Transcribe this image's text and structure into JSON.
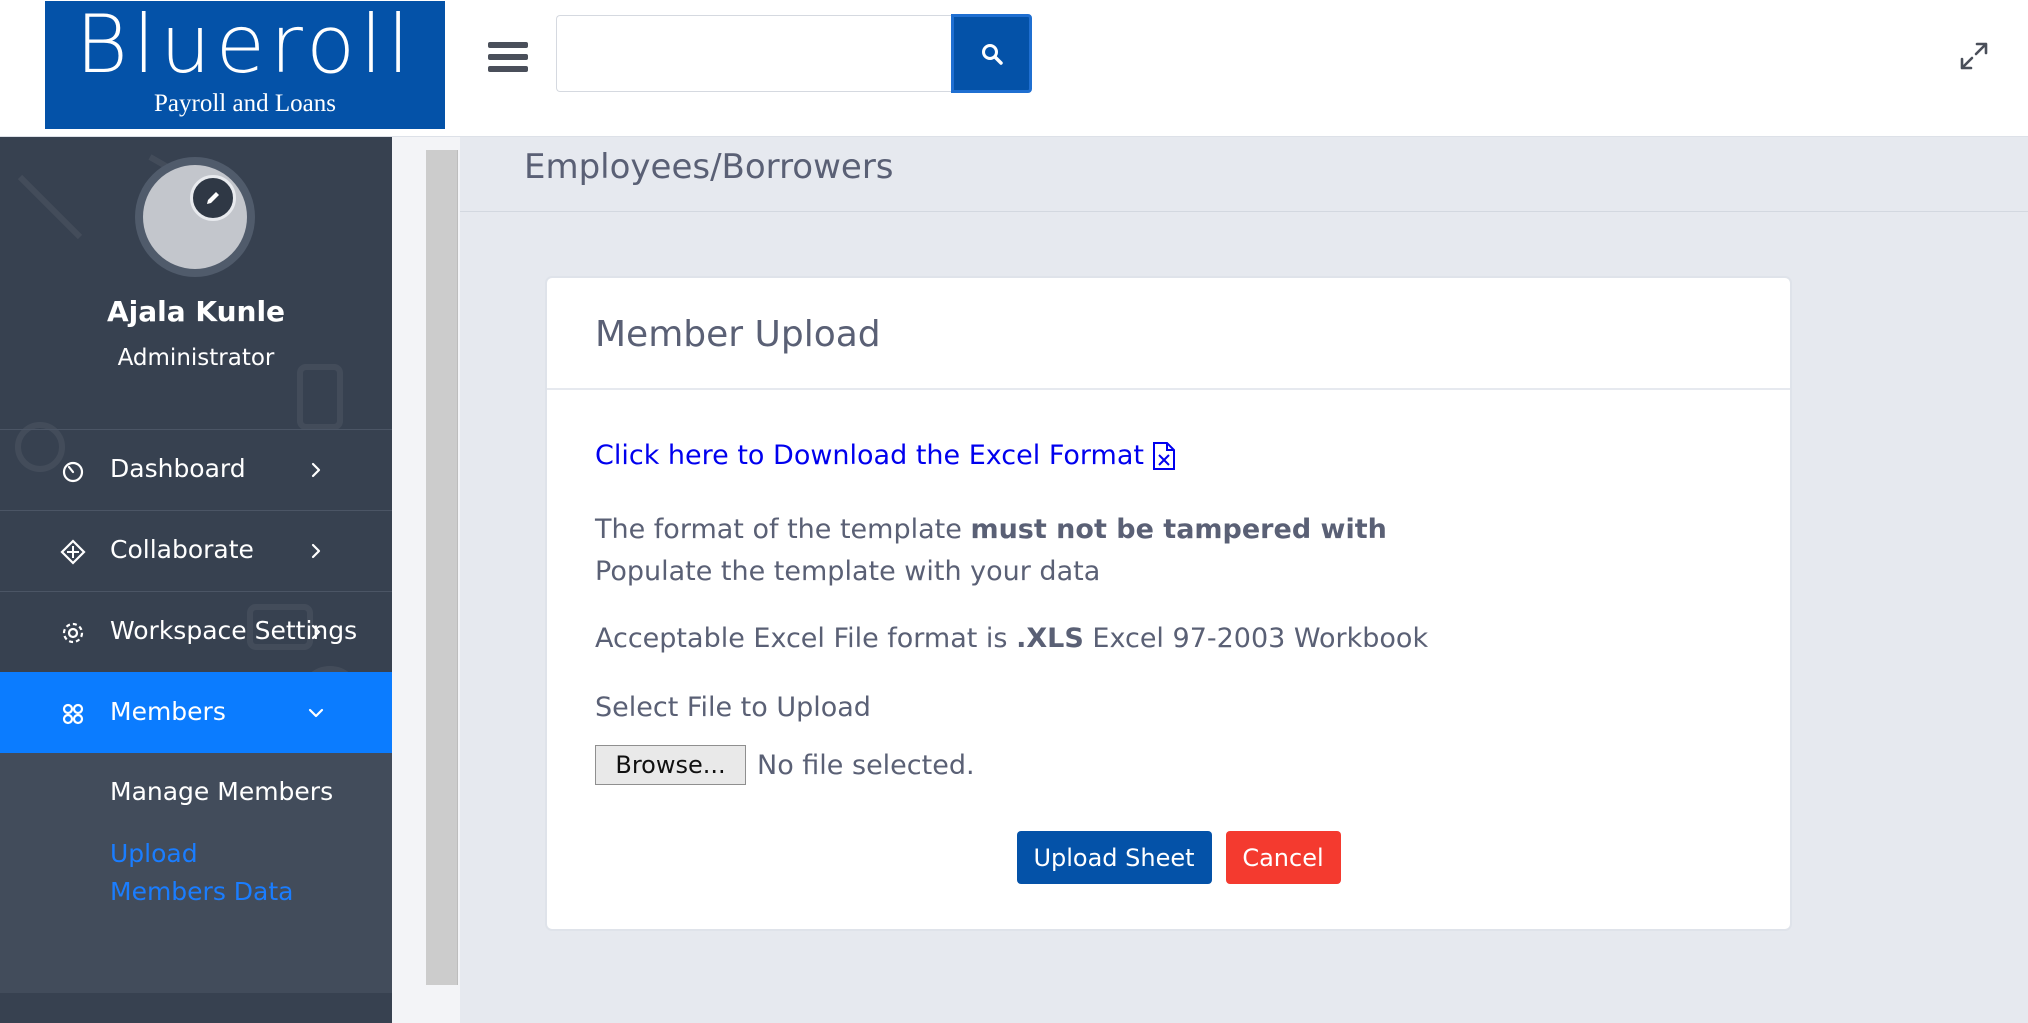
{
  "brand": {
    "name": "Blueroll",
    "tagline": "Payroll and Loans",
    "color": "#0452a8"
  },
  "header": {
    "search": {
      "placeholder": "",
      "value": "",
      "icon": "search-icon"
    },
    "menu_icon": "hamburger-icon",
    "expand_icon": "expand-icon"
  },
  "user": {
    "name": "Ajala Kunle",
    "role": "Administrator",
    "edit_icon": "pencil-icon"
  },
  "sidebar": {
    "items": [
      {
        "label": "Dashboard",
        "icon": "dashboard-icon",
        "chevron": "chevron-right-icon"
      },
      {
        "label": "Collaborate",
        "icon": "collaborate-icon",
        "chevron": "chevron-right-icon"
      },
      {
        "label": "Workspace Settings",
        "icon": "gear-icon",
        "chevron": "chevron-right-icon"
      },
      {
        "label": "Members",
        "icon": "members-icon",
        "chevron": "chevron-down-icon",
        "active": true
      }
    ],
    "submenu": [
      {
        "label": "Manage Members"
      },
      {
        "label": "Upload Members Data",
        "active": true
      }
    ],
    "active_color": "#0b7cff"
  },
  "page": {
    "title": "Employees/Borrowers"
  },
  "card": {
    "title": "Member Upload",
    "download_link": "Click here to Download the Excel Format",
    "download_icon": "excel-file-icon",
    "line1_prefix": "The format of the template ",
    "line1_bold": "must not be tampered with",
    "line2": "Populate the template with your data",
    "format_prefix": "Acceptable Excel File format is ",
    "format_bold": ".XLS",
    "format_suffix": " Excel 97-2003 Workbook",
    "select_label": "Select File to Upload",
    "browse_label": "Browse...",
    "no_file": "No file selected.",
    "upload_label": "Upload Sheet",
    "cancel_label": "Cancel",
    "upload_color": "#0452a8",
    "cancel_color": "#f43a2f"
  }
}
